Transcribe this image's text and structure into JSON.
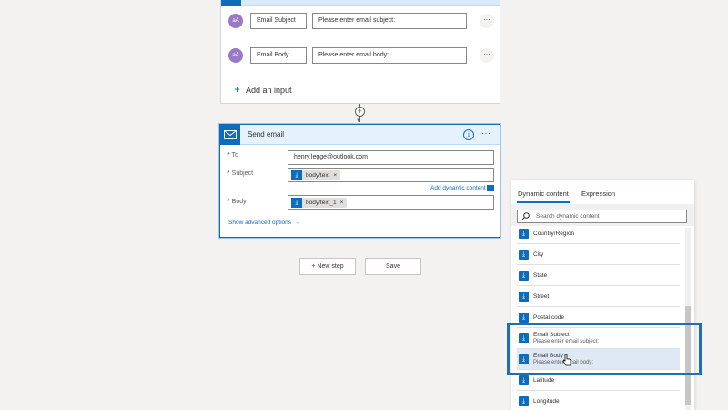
{
  "trigger": {
    "rows": [
      {
        "avatar": "aA",
        "label": "Email Subject",
        "placeholder": "Please enter email subject:"
      },
      {
        "avatar": "aA",
        "label": "Email Body",
        "placeholder": "Please enter email body:"
      }
    ],
    "add_input_label": "Add an input",
    "dots": "···"
  },
  "send_email": {
    "title": "Send email",
    "info": "i",
    "menu": "···",
    "to_label": "* To",
    "to_value": "henry.legge@outlook.com",
    "subject_label": "* Subject",
    "subject_token": "body/text",
    "body_label": "* Body",
    "body_token": "body/text_1",
    "token_remove": "×",
    "add_dynamic_label": "Add dynamic content",
    "advanced_label": "Show advanced options",
    "advanced_chevron": "⌵"
  },
  "actions": {
    "new_step_label": "+ New step",
    "save_label": "Save"
  },
  "dynamic_panel": {
    "tab_dynamic": "Dynamic content",
    "tab_expression": "Expression",
    "search_placeholder": "Search dynamic content",
    "items": [
      {
        "label": "Country/Region"
      },
      {
        "label": "City"
      },
      {
        "label": "State"
      },
      {
        "label": "Street"
      },
      {
        "label": "Postal code"
      },
      {
        "label": "Email Subject",
        "sub": "Please enter email subject:"
      },
      {
        "label": "Email Body",
        "sub": "Please enter email body:"
      },
      {
        "label": "Latitude"
      },
      {
        "label": "Longitude"
      }
    ]
  },
  "colors": {
    "accent": "#0f6cbd",
    "highlight_border": "#1f6fb5",
    "avatar": "#9a79c7"
  }
}
